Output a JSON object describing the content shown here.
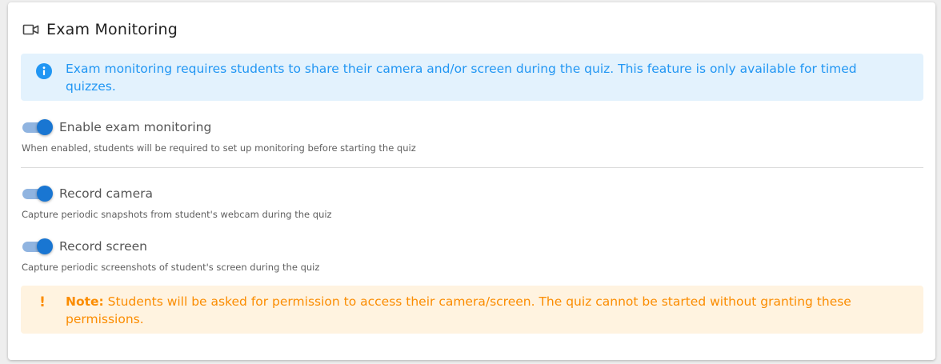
{
  "section": {
    "title": "Exam Monitoring",
    "icon": "video-camera-icon"
  },
  "info_alert": {
    "icon": "info-icon",
    "text": "Exam monitoring requires students to share their camera and/or screen during the quiz. This feature is only available for timed quizzes."
  },
  "toggles": {
    "enable": {
      "label": "Enable exam monitoring",
      "hint": "When enabled, students will be required to set up monitoring before starting the quiz",
      "on": true
    },
    "camera": {
      "label": "Record camera",
      "hint": "Capture periodic snapshots from student's webcam during the quiz",
      "on": true
    },
    "screen": {
      "label": "Record screen",
      "hint": "Capture periodic screenshots of student's screen during the quiz",
      "on": true
    }
  },
  "warning_alert": {
    "icon": "exclamation-icon",
    "label": "Note:",
    "text": " Students will be asked for permission to access their camera/screen. The quiz cannot be started without granting these permissions."
  },
  "colors": {
    "accent": "#1976d2",
    "info_bg": "#e3f2fd",
    "info_text": "#2196f3",
    "warn_bg": "#fff3e0",
    "warn_text": "#fb8c00"
  }
}
